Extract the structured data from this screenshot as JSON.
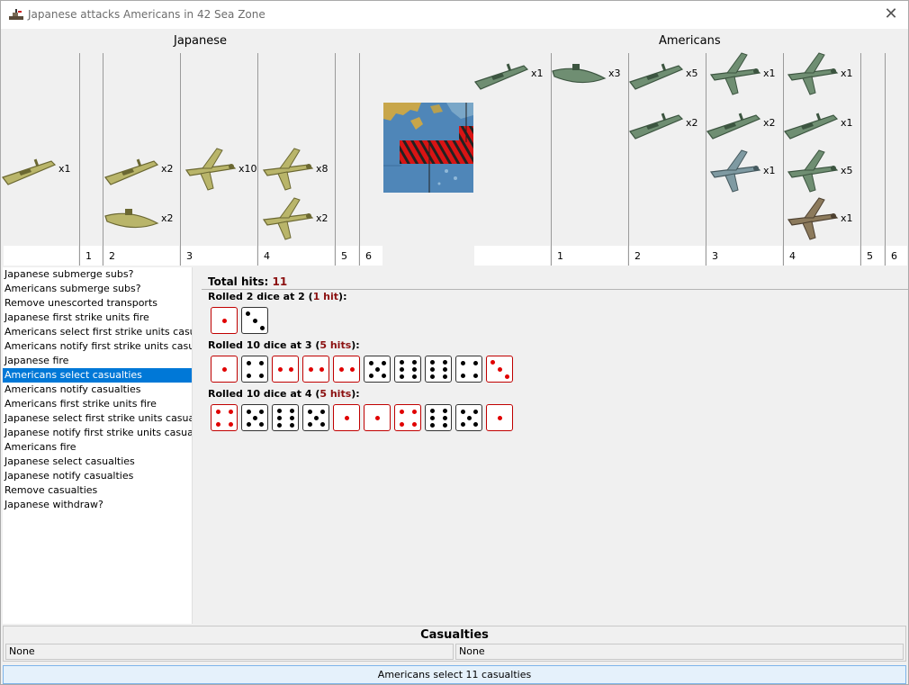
{
  "window": {
    "title": "Japanese attacks Americans in 42 Sea Zone",
    "app_icon": "battleship-icon",
    "close_icon": "close-icon"
  },
  "japanese": {
    "name": "Japanese",
    "column_labels": [
      "",
      "1",
      "2",
      "3",
      "4",
      "5",
      "6"
    ],
    "units": [
      {
        "name": "transport",
        "count": "x1"
      },
      {
        "name": "destroyer",
        "count": "x2"
      },
      {
        "name": "submarine",
        "count": "x2"
      },
      {
        "name": "fighter",
        "count": "x10"
      },
      {
        "name": "tactical-bomber",
        "count": "x8"
      },
      {
        "name": "bomber",
        "count": "x2"
      }
    ]
  },
  "americans": {
    "name": "Americans",
    "column_labels": [
      "",
      "1",
      "2",
      "3",
      "4",
      "5",
      "6"
    ],
    "units": [
      {
        "name": "transport",
        "count": "x1"
      },
      {
        "name": "submarine",
        "count": "x3"
      },
      {
        "name": "carrier",
        "count": "x5"
      },
      {
        "name": "destroyer",
        "count": "x2"
      },
      {
        "name": "tactical-bomber",
        "count": "x1"
      },
      {
        "name": "cruiser",
        "count": "x2"
      },
      {
        "name": "fighter-3",
        "count": "x1"
      },
      {
        "name": "fighter",
        "count": "x1"
      },
      {
        "name": "battleship",
        "count": "x1"
      },
      {
        "name": "fighter-green",
        "count": "x5"
      },
      {
        "name": "fighter-brown",
        "count": "x1"
      }
    ]
  },
  "steps": [
    "Japanese submerge subs?",
    "Americans submerge subs?",
    "Remove unescorted transports",
    "Japanese first strike units fire",
    "Americans select first strike units casualties",
    "Americans notify first strike units casualties",
    "Japanese fire",
    "Americans select casualties",
    "Americans notify casualties",
    "Americans first strike units fire",
    "Japanese select first strike units casualties",
    "Japanese notify first strike units casualties",
    "Americans fire",
    "Japanese select casualties",
    "Japanese notify casualties",
    "Remove casualties",
    "Japanese withdraw?"
  ],
  "selected_step": 7,
  "results": {
    "total_label": "Total hits:",
    "total_value": "11",
    "rolls": [
      {
        "prefix": "Rolled 2 dice at 2 (",
        "hits": "1 hit",
        "suffix": "):",
        "dice": [
          1,
          3
        ],
        "threshold": 2
      },
      {
        "prefix": "Rolled 10 dice at 3 (",
        "hits": "5 hits",
        "suffix": "):",
        "dice": [
          1,
          4,
          2,
          2,
          2,
          5,
          6,
          6,
          4,
          3
        ],
        "threshold": 3
      },
      {
        "prefix": "Rolled 10 dice at 4 (",
        "hits": "5 hits",
        "suffix": "):",
        "dice": [
          4,
          5,
          6,
          5,
          1,
          1,
          4,
          6,
          5,
          1
        ],
        "threshold": 4
      }
    ]
  },
  "casualties": {
    "title": "Casualties",
    "left": "None",
    "right": "None"
  },
  "status": "Americans select 11 casualties",
  "colors": {
    "selected": "#0078d7",
    "hit_red": "#e00000",
    "hits_text": "#8b1010",
    "jp_unit": "#b9b56a",
    "us_unit": "#6f8e72"
  }
}
